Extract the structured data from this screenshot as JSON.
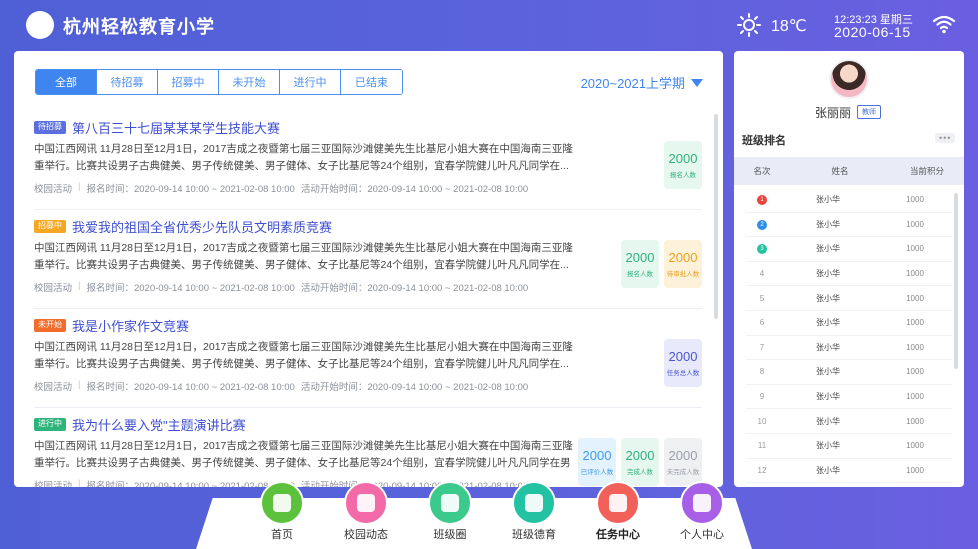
{
  "header": {
    "school_name": "杭州轻松教育小学",
    "temperature": "18℃",
    "time": "12:23:23 星期三",
    "date": "2020-06-15"
  },
  "tabs": [
    {
      "label": "全部",
      "active": true
    },
    {
      "label": "待招募",
      "active": false
    },
    {
      "label": "招募中",
      "active": false
    },
    {
      "label": "未开始",
      "active": false
    },
    {
      "label": "进行中",
      "active": false
    },
    {
      "label": "已结束",
      "active": false
    }
  ],
  "semester": "2020~2021上学期",
  "activities": [
    {
      "status": "待招募",
      "status_color": "#5b6fe0",
      "title": "第八百三十七届某某某学生技能大赛",
      "desc": "中国江西网讯 11月28日至12月1日，2017吉成之夜暨第七届三亚国际沙滩健美先生比基尼小姐大赛在中国海南三亚隆重举行。比赛共设男子古典健美、男子传统健美、男子健体、女子比基尼等24个组别，宜春学院健儿叶凡凡同学在...",
      "category": "校园活动",
      "signup_time": "报名时间：2020-09-14 10:00 ~ 2021-02-08 10:00",
      "start_time": "活动开始时间：2020-09-14 10:00 ~ 2021-02-08 10:00",
      "stats": [
        {
          "num": "2000",
          "label": "报名人数",
          "fg": "#2fb37c",
          "bg": "#e5f7ef"
        }
      ]
    },
    {
      "status": "招募中",
      "status_color": "#f5a623",
      "title": "我爱我的祖国全省优秀少先队员文明素质竞赛",
      "desc": "中国江西网讯 11月28日至12月1日，2017吉成之夜暨第七届三亚国际沙滩健美先生比基尼小姐大赛在中国海南三亚隆重举行。比赛共设男子古典健美、男子传统健美、男子健体、女子比基尼等24个组别，宜春学院健儿叶凡凡同学在...",
      "category": "校园活动",
      "signup_time": "报名时间：2020-09-14 10:00 ~ 2021-02-08 10:00",
      "start_time": "活动开始时间：2020-09-14 10:00 ~ 2021-02-08 10:00",
      "stats": [
        {
          "num": "2000",
          "label": "报名人数",
          "fg": "#2fb37c",
          "bg": "#e5f7ef"
        },
        {
          "num": "2000",
          "label": "待审批人数",
          "fg": "#e9a21f",
          "bg": "#fdf1da"
        }
      ]
    },
    {
      "status": "未开始",
      "status_color": "#f26c2c",
      "title": "我是小作家作文竞赛",
      "desc": "中国江西网讯 11月28日至12月1日，2017吉成之夜暨第七届三亚国际沙滩健美先生比基尼小姐大赛在中国海南三亚隆重举行。比赛共设男子古典健美、男子传统健美、男子健体、女子比基尼等24个组别，宜春学院健儿叶凡凡同学在...",
      "category": "校园活动",
      "signup_time": "报名时间：2020-09-14 10:00 ~ 2021-02-08 10:00",
      "start_time": "活动开始时间：2020-09-14 10:00 ~ 2021-02-08 10:00",
      "stats": [
        {
          "num": "2000",
          "label": "任务总人数",
          "fg": "#4a55d6",
          "bg": "#e8eafb"
        }
      ]
    },
    {
      "status": "进行中",
      "status_color": "#2fb37c",
      "title": "我为什么要入党\"主题演讲比赛",
      "desc": "中国江西网讯 11月28日至12月1日，2017吉成之夜暨第七届三亚国际沙滩健美先生比基尼小姐大赛在中国海南三亚隆重举行。比赛共设男子古典健美、男子传统健美、男子健体、女子比基尼等24个组别，宜春学院健儿叶凡凡同学在男",
      "category": "校园活动",
      "signup_time": "报名时间：2020-09-14 10:00 ~ 2021-02-08 10:00",
      "start_time": "活动开始时间：2020-09-14 10:00 ~ 2021-02-08 10:00",
      "stats": [
        {
          "num": "2000",
          "label": "已评价人数",
          "fg": "#3b9cf0",
          "bg": "#e4f2fd"
        },
        {
          "num": "2000",
          "label": "完成人数",
          "fg": "#2fb37c",
          "bg": "#e5f7ef"
        },
        {
          "num": "2000",
          "label": "未完成人数",
          "fg": "#9aa0a8",
          "bg": "#eef0f2"
        }
      ]
    }
  ],
  "profile": {
    "name": "张丽丽",
    "role": "教师"
  },
  "ranking": {
    "title": "班级排名",
    "more": "•••",
    "headers": [
      "名次",
      "姓名",
      "当前积分"
    ],
    "rows": [
      {
        "rank": "1",
        "name": "张小华",
        "score": "1000",
        "medal": "#e8453c"
      },
      {
        "rank": "2",
        "name": "张小华",
        "score": "1000",
        "medal": "#2f8ee8"
      },
      {
        "rank": "3",
        "name": "张小华",
        "score": "1000",
        "medal": "#25c2a0"
      },
      {
        "rank": "4",
        "name": "张小华",
        "score": "1000"
      },
      {
        "rank": "5",
        "name": "张小华",
        "score": "1000"
      },
      {
        "rank": "6",
        "name": "张小华",
        "score": "1000"
      },
      {
        "rank": "7",
        "name": "张小华",
        "score": "1000"
      },
      {
        "rank": "8",
        "name": "张小华",
        "score": "1000"
      },
      {
        "rank": "9",
        "name": "张小华",
        "score": "1000"
      },
      {
        "rank": "10",
        "name": "张小华",
        "score": "1000"
      },
      {
        "rank": "11",
        "name": "张小华",
        "score": "1000"
      },
      {
        "rank": "12",
        "name": "张小华",
        "score": "1000"
      }
    ]
  },
  "nav": [
    {
      "label": "首页",
      "icon": "pinwheel-icon",
      "color": "#5cc23b",
      "active": false
    },
    {
      "label": "校园动态",
      "icon": "flower-icon",
      "color": "#f36aa8",
      "active": false
    },
    {
      "label": "班级圈",
      "icon": "b-letter-icon",
      "color": "#3cc98c",
      "active": false
    },
    {
      "label": "班级德育",
      "icon": "book-icon",
      "color": "#22c2a2",
      "active": false
    },
    {
      "label": "任务中心",
      "icon": "task-icon",
      "color": "#f2605a",
      "active": true
    },
    {
      "label": "个人中心",
      "icon": "person-icon",
      "color": "#a65fe6",
      "active": false
    }
  ]
}
